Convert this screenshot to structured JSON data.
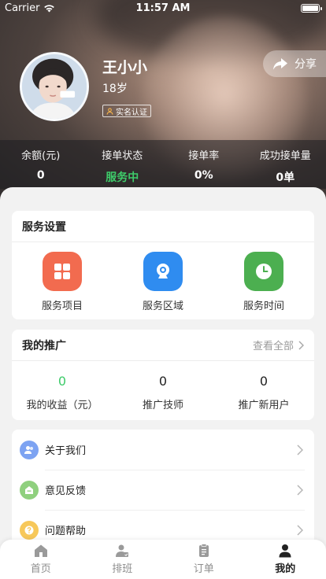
{
  "status_bar": {
    "carrier": "Carrier",
    "time": "11:57 AM"
  },
  "profile": {
    "name": "王小小",
    "age": "18岁",
    "verified_label": "实名认证"
  },
  "share": {
    "label": "分享"
  },
  "stats": [
    {
      "label": "余额(元)",
      "value": "0"
    },
    {
      "label": "接单状态",
      "value": "服务中"
    },
    {
      "label": "接单率",
      "value": "0%"
    },
    {
      "label": "成功接单量",
      "value": "0单"
    }
  ],
  "service_settings": {
    "title": "服务设置",
    "items": [
      {
        "label": "服务项目",
        "icon": "grid-icon",
        "color": "#f26b4f"
      },
      {
        "label": "服务区域",
        "icon": "camera-icon",
        "color": "#2f8cf0"
      },
      {
        "label": "服务时间",
        "icon": "clock-icon",
        "color": "#4caf50"
      }
    ]
  },
  "promotion": {
    "title": "我的推广",
    "view_all": "查看全部",
    "items": [
      {
        "value": "0",
        "label": "我的收益（元）"
      },
      {
        "value": "0",
        "label": "推广技师"
      },
      {
        "value": "0",
        "label": "推广新用户"
      }
    ]
  },
  "menu": [
    {
      "label": "关于我们",
      "icon": "users-icon",
      "color": "#7da3f2"
    },
    {
      "label": "意见反馈",
      "icon": "feedback-icon",
      "color": "#8fd07e"
    },
    {
      "label": "问题帮助",
      "icon": "help-icon",
      "color": "#f7c85a"
    }
  ],
  "tabbar": [
    {
      "label": "首页",
      "icon": "home-icon"
    },
    {
      "label": "排班",
      "icon": "schedule-icon"
    },
    {
      "label": "订单",
      "icon": "clipboard-icon"
    },
    {
      "label": "我的",
      "icon": "person-icon",
      "active": true
    }
  ],
  "colors": {
    "accent_green": "#3ecb6a",
    "text_primary": "#222222",
    "text_muted": "#9a9a9a"
  }
}
